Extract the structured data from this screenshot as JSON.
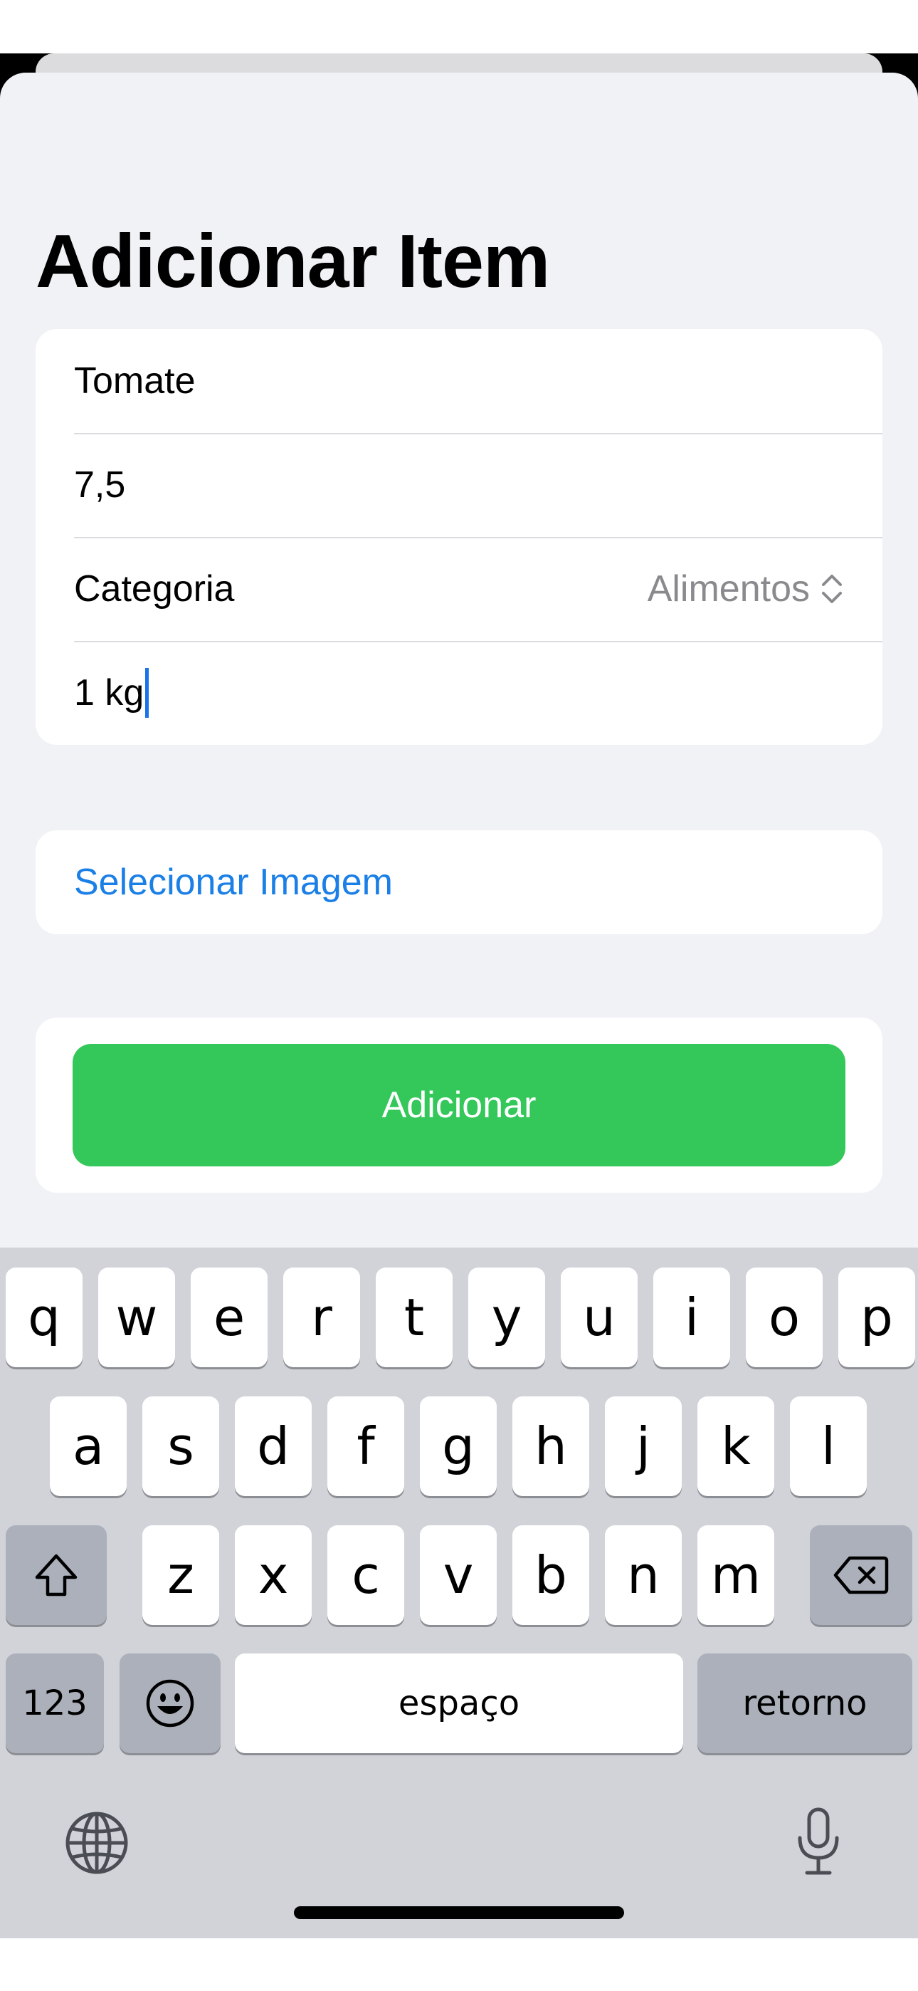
{
  "page": {
    "title": "Adicionar Item"
  },
  "form": {
    "name_value": "Tomate",
    "price_value": "7,5",
    "category_label": "Categoria",
    "category_value": "Alimentos",
    "quantity_value": "1 kg"
  },
  "image_section": {
    "select_label": "Selecionar Imagem"
  },
  "actions": {
    "add_label": "Adicionar"
  },
  "keyboard": {
    "row1": [
      "q",
      "w",
      "e",
      "r",
      "t",
      "y",
      "u",
      "i",
      "o",
      "p"
    ],
    "row2": [
      "a",
      "s",
      "d",
      "f",
      "g",
      "h",
      "j",
      "k",
      "l"
    ],
    "row3": [
      "z",
      "x",
      "c",
      "v",
      "b",
      "n",
      "m"
    ],
    "numbers_label": "123",
    "space_label": "espaço",
    "return_label": "retorno"
  },
  "icons": {
    "chevron": "chevron-up-down-icon",
    "shift": "shift-icon",
    "delete": "delete-icon",
    "emoji": "emoji-icon",
    "globe": "globe-icon",
    "mic": "microphone-icon"
  },
  "colors": {
    "accent": "#1a7fe6",
    "add_button": "#34c75a",
    "background": "#f1f2f6"
  }
}
